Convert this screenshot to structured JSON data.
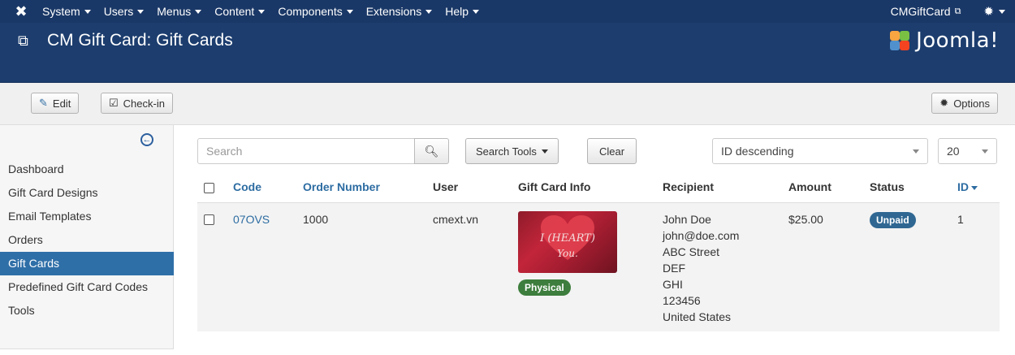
{
  "topbar": {
    "logo_icon": "joomla-icon",
    "menu": [
      {
        "label": "System"
      },
      {
        "label": "Users"
      },
      {
        "label": "Menus"
      },
      {
        "label": "Content"
      },
      {
        "label": "Components"
      },
      {
        "label": "Extensions"
      },
      {
        "label": "Help"
      }
    ],
    "site_link": "CMGiftCard",
    "settings_icon": "gear-icon"
  },
  "header": {
    "title": "CM Gift Card: Gift Cards",
    "brand": "Joomla!"
  },
  "toolbar": {
    "edit_label": "Edit",
    "checkin_label": "Check-in",
    "options_label": "Options"
  },
  "sidebar": {
    "items": [
      {
        "label": "Dashboard",
        "active": false
      },
      {
        "label": "Gift Card Designs",
        "active": false
      },
      {
        "label": "Email Templates",
        "active": false
      },
      {
        "label": "Orders",
        "active": false
      },
      {
        "label": "Gift Cards",
        "active": true
      },
      {
        "label": "Predefined Gift Card Codes",
        "active": false
      },
      {
        "label": "Tools",
        "active": false
      }
    ]
  },
  "filters": {
    "search_placeholder": "Search",
    "search_tools_label": "Search Tools",
    "clear_label": "Clear",
    "sort_value": "ID descending",
    "limit_value": "20"
  },
  "table": {
    "headers": {
      "code": "Code",
      "order_number": "Order Number",
      "user": "User",
      "gift_card_info": "Gift Card Info",
      "recipient": "Recipient",
      "amount": "Amount",
      "status": "Status",
      "id": "ID"
    },
    "rows": [
      {
        "code": "07OVS",
        "order_number": "1000",
        "user": "cmext.vn",
        "card_image_text_line1": "I (HEART)",
        "card_image_text_line2": "You.",
        "card_type": "Physical",
        "recipient": {
          "name": "John Doe",
          "email": "john@doe.com",
          "line1": "ABC Street",
          "line2": "DEF",
          "line3": "GHI",
          "zip": "123456",
          "country": "United States"
        },
        "amount": "$25.00",
        "status": "Unpaid",
        "id": "1"
      }
    ]
  },
  "colors": {
    "topbar": "#1a3867",
    "titlebar": "#1c3d6e",
    "link": "#2d6ca2",
    "active_sidebar": "#2f6fa8",
    "physical_badge": "#3d7d3d",
    "unpaid_badge": "#2f6792"
  }
}
